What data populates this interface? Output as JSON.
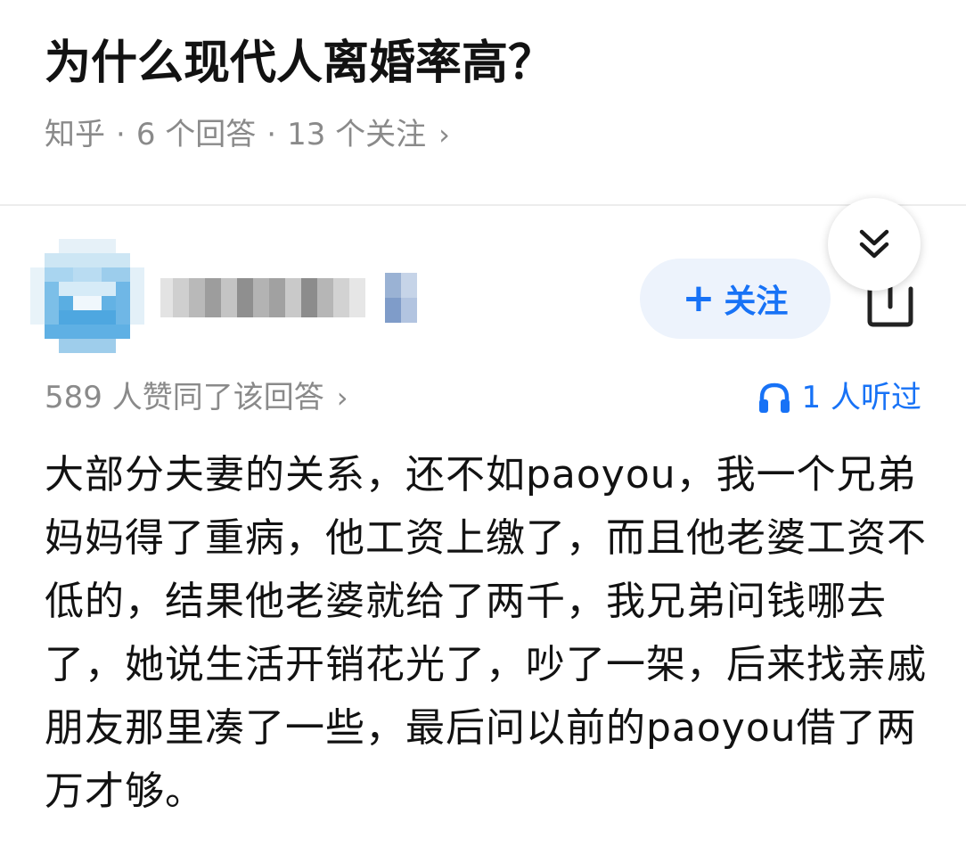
{
  "question": {
    "title": "为什么现代人离婚率高？",
    "source": "知乎",
    "dot": "·",
    "answers": "6 个回答",
    "followers": "13 个关注",
    "chevron": "›"
  },
  "author": {
    "avatar_icon": "avatar-blurred",
    "name_icon": "blurred-name"
  },
  "actions": {
    "follow_plus": "+",
    "follow_label": "关注",
    "collapse_icon": "double-chevron-down-icon",
    "share_icon": "share-icon"
  },
  "stats": {
    "upvotes": "589 人赞同了该回答",
    "upvotes_chevron": "›",
    "listeners": "1 人听过",
    "accent_color": "#1772f6"
  },
  "answer": {
    "text": "大部分夫妻的关系，还不如paoyou，我一个兄弟妈妈得了重病，他工资上缴了，而且他老婆工资不低的，结果他老婆就给了两千，我兄弟问钱哪去了，她说生活开销花光了，吵了一架，后来找亲戚朋友那里凑了一些，最后问以前的paoyou借了两万才够。"
  }
}
